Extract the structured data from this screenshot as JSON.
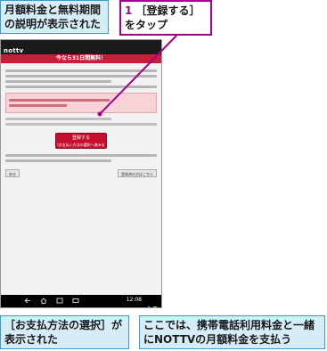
{
  "callouts": {
    "top_left": "月額料金と無料期間の説明が表示された",
    "top_right_step": "1",
    "top_right_text": "［登録する］をタップ",
    "bottom_left": "［お支払方法の選択］が表示された",
    "bottom_right": "ここでは、携帯電話利用料金と一緒にNOTTVの月額料金を支払う"
  },
  "tablet": {
    "logo": "nottv",
    "banner": "今なら31日間無料！",
    "register_button": "登録する",
    "register_button_sub": "(お支払い方法の選択へ進みます)",
    "back_button": "戻る",
    "next_button": "登録済の方はこちら",
    "clock": "12:08"
  },
  "colors": {
    "accent": "#a3008c",
    "callout_blue_bg": "#d6ecf7",
    "callout_blue_border": "#3a9ccc",
    "brand_red": "#c40f2e"
  },
  "icons": [
    "back-nav-icon",
    "home-nav-icon",
    "recent-apps-nav-icon",
    "screenshot-icon",
    "wifi-icon",
    "battery-icon"
  ]
}
